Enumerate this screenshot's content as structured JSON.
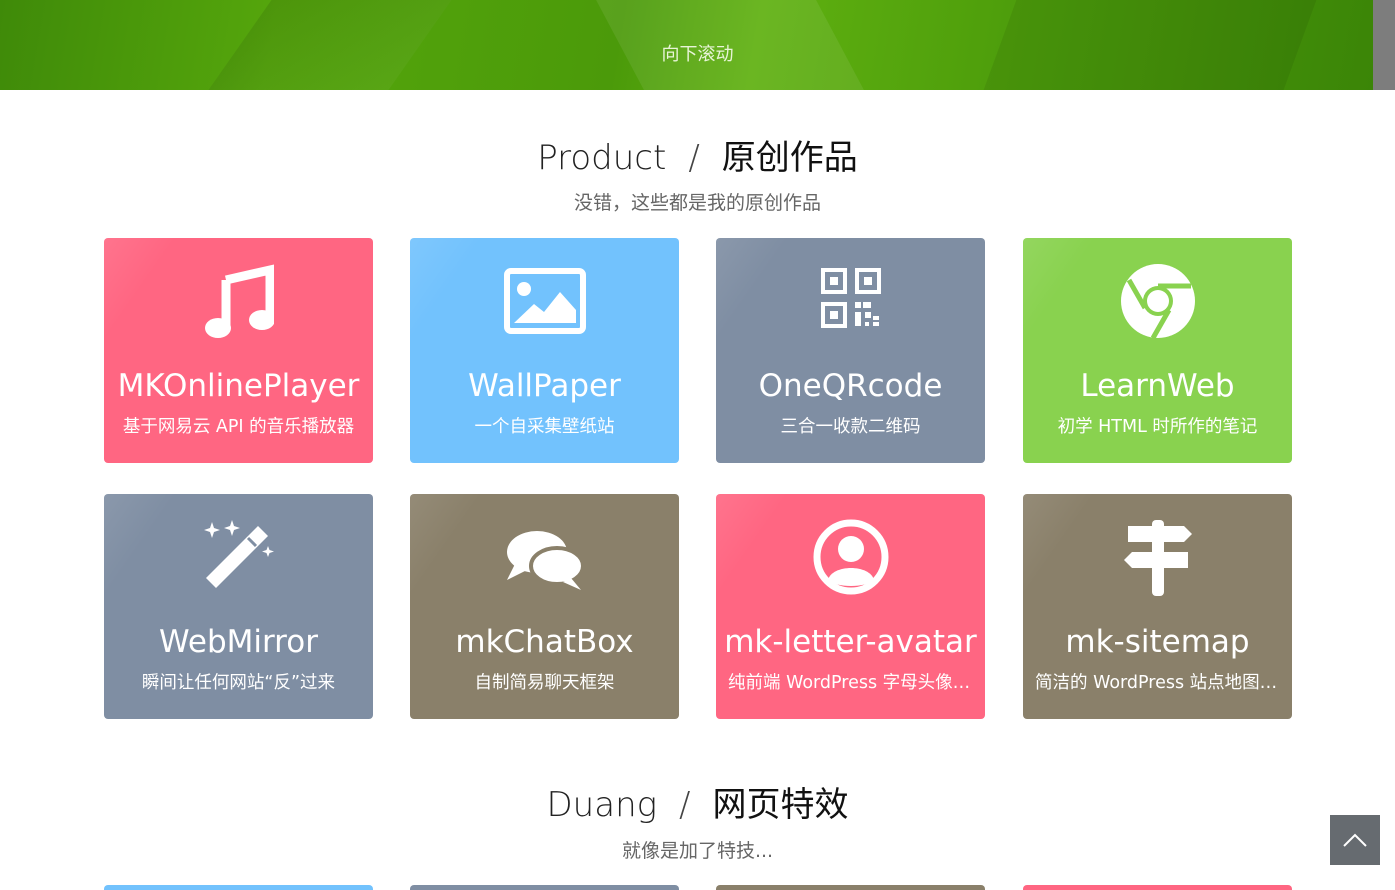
{
  "banner": {
    "scroll_hint": "向下滚动"
  },
  "sections": [
    {
      "title_en": "Product",
      "separator": "/",
      "title_cn": "原创作品",
      "subtitle": "没错，这些都是我的原创作品"
    },
    {
      "title_en": "Duang",
      "separator": "/",
      "title_cn": "网页特效",
      "subtitle": "就像是加了特技..."
    }
  ],
  "cards": [
    {
      "title": "MKOnlinePlayer",
      "desc": "基于网易云 API 的音乐播放器",
      "icon": "music-note-icon",
      "color": "#ff6682"
    },
    {
      "title": "WallPaper",
      "desc": "一个自采集壁纸站",
      "icon": "image-icon",
      "color": "#72c2fd"
    },
    {
      "title": "OneQRcode",
      "desc": "三合一收款二维码",
      "icon": "qrcode-icon",
      "color": "#7f8ea3"
    },
    {
      "title": "LearnWeb",
      "desc": "初学 HTML 时所作的笔记",
      "icon": "chrome-icon",
      "color": "#89d24f"
    },
    {
      "title": "WebMirror",
      "desc": "瞬间让任何网站“反”过来",
      "icon": "magic-wand-icon",
      "color": "#7f8ea3"
    },
    {
      "title": "mkChatBox",
      "desc": "自制简易聊天框架",
      "icon": "chat-bubbles-icon",
      "color": "#8a806a"
    },
    {
      "title": "mk-letter-avatar",
      "desc": "纯前端 WordPress 字母头像插件",
      "icon": "user-circle-icon",
      "color": "#ff6682"
    },
    {
      "title": "mk-sitemap",
      "desc": "简洁的 WordPress 站点地图插件",
      "icon": "signpost-icon",
      "color": "#8a806a"
    }
  ],
  "back_to_top": {
    "icon": "chevron-up-icon"
  }
}
